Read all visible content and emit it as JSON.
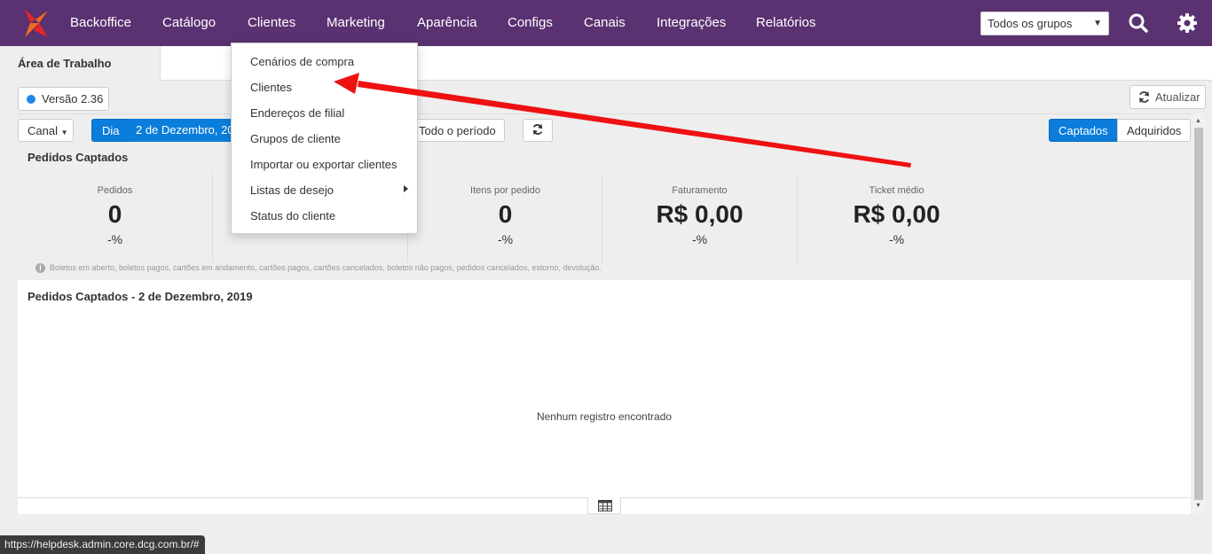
{
  "colors": {
    "topbar": "#5a3171",
    "primary": "#0b7dda",
    "arrow": "#ee1111",
    "logo_orange": "#f26a1f",
    "logo_red": "#e4252b"
  },
  "topnav": {
    "items": [
      "Backoffice",
      "Catálogo",
      "Clientes",
      "Marketing",
      "Aparência",
      "Configs",
      "Canais",
      "Integrações",
      "Relatórios"
    ],
    "group_select": "Todos os grupos",
    "icons": [
      "search-icon",
      "gear-icon"
    ]
  },
  "tabs": {
    "active": "Área de Trabalho"
  },
  "version": "Versão 2.36",
  "refresh_button": "Atualizar",
  "filters": {
    "canal": "Canal",
    "day": "Dia",
    "date": "2 de Dezembro, 2019",
    "period": "Todo o período",
    "toggle": [
      "Captados",
      "Adquiridos"
    ],
    "toggle_selected": "Captados"
  },
  "summary": {
    "title": "Pedidos Captados",
    "stats": [
      {
        "label": "Pedidos",
        "value": "0",
        "pct": "-%"
      },
      {
        "label": "",
        "value": "",
        "pct": "-%"
      },
      {
        "label": "Itens por pedido",
        "value": "0",
        "pct": "-%"
      },
      {
        "label": "Faturamento",
        "value": "R$ 0,00",
        "pct": "-%"
      },
      {
        "label": "Ticket médio",
        "value": "R$ 0,00",
        "pct": "-%"
      }
    ],
    "note": "Boletos em aberto, boletos pagos, cartões em andamento, cartões pagos, cartões cancelados, boletos não pagos, pedidos cancelados, estorno, devolução."
  },
  "panel": {
    "title": "Pedidos Captados - 2 de Dezembro, 2019",
    "empty": "Nenhum registro encontrado"
  },
  "dropdown": {
    "items": [
      "Cenários de compra",
      "Clientes",
      "Endereços de filial",
      "Grupos de cliente",
      "Importar ou exportar clientes",
      "Listas de desejo",
      "Status do cliente"
    ]
  },
  "status_url": "https://helpdesk.admin.core.dcg.com.br/#"
}
